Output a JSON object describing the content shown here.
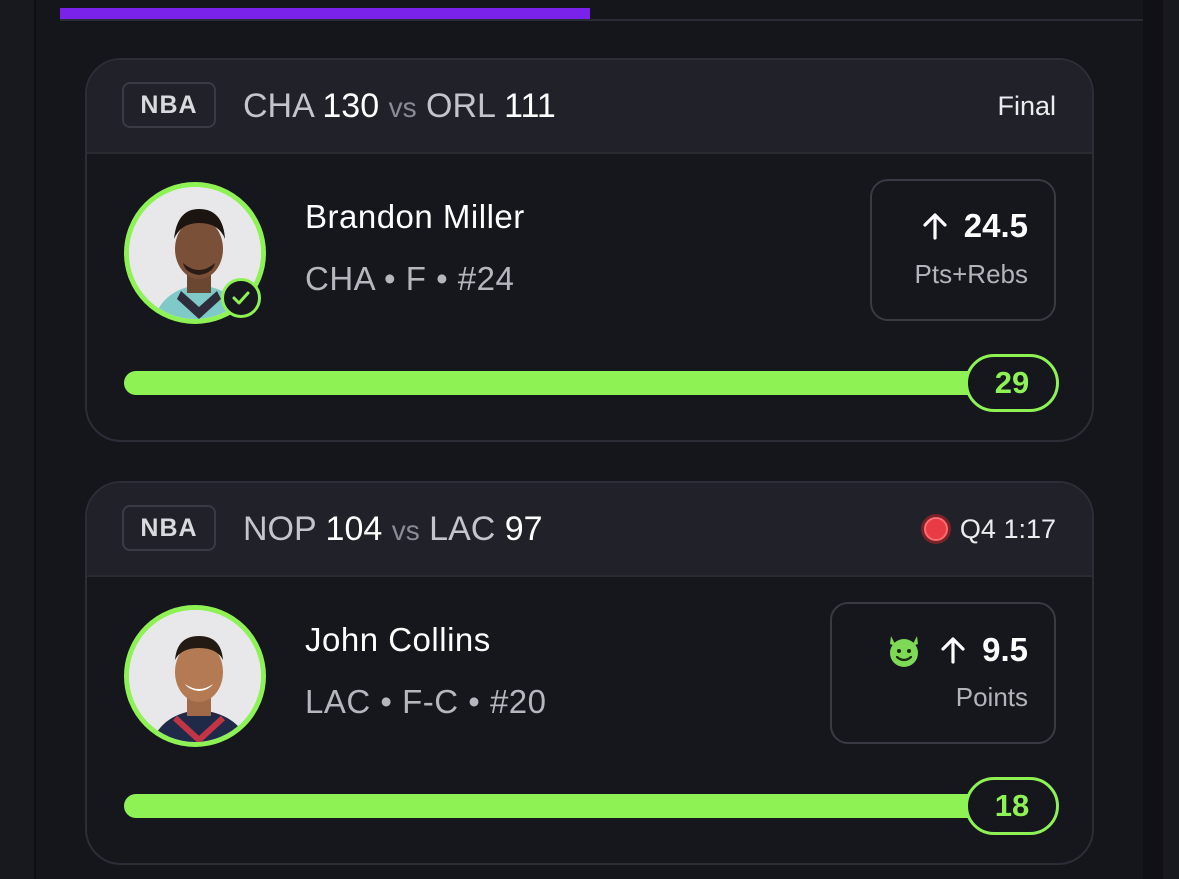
{
  "colors": {
    "accent_green": "#8ef255",
    "tab_indicator": "#7b22ea",
    "live_red": "#e83b44",
    "background": "#14141b",
    "card_header": "#212129"
  },
  "cards": [
    {
      "league": "NBA",
      "home_team": "CHA",
      "home_score": "130",
      "vs": "vs",
      "away_team": "ORL",
      "away_score": "111",
      "status": "Final",
      "live": false,
      "player": {
        "name": "Brandon Miller",
        "meta": "CHA • F • #24",
        "avatar_icon": "player-avatar",
        "verified_icon": "check-circle-icon"
      },
      "pick": {
        "direction_icon": "arrow-up-icon",
        "line": "24.5",
        "stat": "Pts+Rebs"
      },
      "result": "29",
      "progress_fraction": 1.0
    },
    {
      "league": "NBA",
      "home_team": "NOP",
      "home_score": "104",
      "vs": "vs",
      "away_team": "LAC",
      "away_score": "97",
      "status": "Q4 1:17",
      "live": true,
      "player": {
        "name": "John Collins",
        "meta": "LAC • F-C • #20",
        "avatar_icon": "player-avatar"
      },
      "pick": {
        "modifier_icon": "green-devil-icon",
        "direction_icon": "arrow-up-icon",
        "line": "9.5",
        "stat": "Points"
      },
      "result": "18",
      "progress_fraction": 1.0
    }
  ]
}
